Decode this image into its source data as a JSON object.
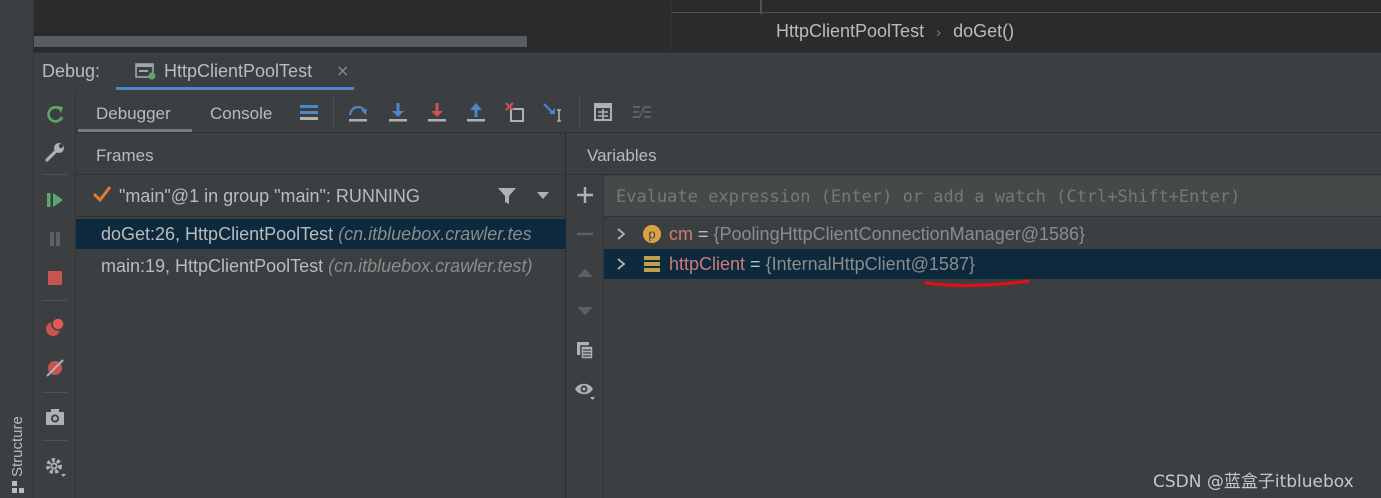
{
  "sidebar": {
    "structure_label": "Structure"
  },
  "editor": {
    "breadcrumb": [
      "HttpClientPoolTest",
      "doGet()"
    ]
  },
  "debug": {
    "label": "Debug:",
    "tab": {
      "title": "HttpClientPoolTest",
      "close": "×"
    }
  },
  "tools": {
    "left_column_icons": [
      "rerun-icon",
      "wrench-icon",
      "resume-icon",
      "pause-icon",
      "stop-icon",
      "view-breakpoints-icon",
      "mute-breakpoints-icon",
      "camera-icon",
      "settings-icon"
    ]
  },
  "tabs": {
    "debugger": "Debugger",
    "console": "Console"
  },
  "toolbar": {
    "icons": [
      "show-execution-point-icon",
      "step-over-icon",
      "step-into-icon",
      "force-step-into-icon",
      "step-out-icon",
      "drop-frame-icon",
      "run-to-cursor-icon",
      "evaluate-expression-icon",
      "trace-current-stream-icon"
    ]
  },
  "frames": {
    "title": "Frames",
    "thread": "\"main\"@1 in group \"main\": RUNNING",
    "rows": [
      {
        "method": "doGet:26, HttpClientPoolTest",
        "pkg": "(cn.itbluebox.crawler.tes"
      },
      {
        "method": "main:19, HttpClientPoolTest",
        "pkg": "(cn.itbluebox.crawler.test)"
      }
    ]
  },
  "variables": {
    "title": "Variables",
    "eval_placeholder": "Evaluate expression (Enter) or add a watch (Ctrl+Shift+Enter)",
    "rows": [
      {
        "name": "cm",
        "eq": " = ",
        "value": "{PoolingHttpClientConnectionManager@1586}",
        "icon_letter": "p"
      },
      {
        "name": "httpClient",
        "eq": " = ",
        "value": "{InternalHttpClient@1587}"
      }
    ]
  },
  "colors": {
    "accent": "#4a88c7",
    "selection": "#0d293e",
    "var_name": "#ce7b77",
    "annotation": "#e0101a"
  },
  "watermark": "CSDN @蓝盒子itbluebox"
}
